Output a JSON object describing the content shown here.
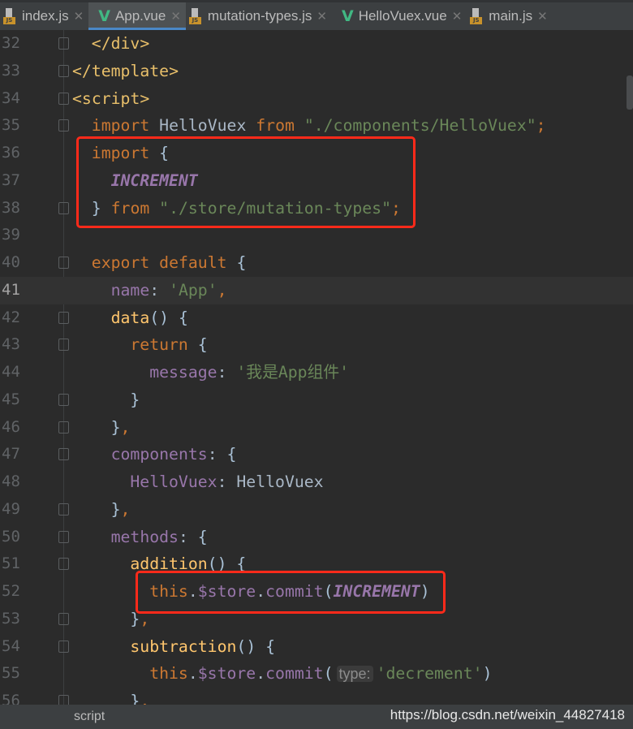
{
  "tabs": [
    {
      "label": "index.js",
      "icon": "js-file-icon",
      "active": false
    },
    {
      "label": "App.vue",
      "icon": "vue-icon",
      "active": true
    },
    {
      "label": "mutation-types.js",
      "icon": "js-file-icon",
      "active": false
    },
    {
      "label": "HelloVuex.vue",
      "icon": "vue-icon",
      "active": false
    },
    {
      "label": "main.js",
      "icon": "js-file-icon",
      "active": false
    }
  ],
  "current_line": 41,
  "lines": [
    {
      "n": "32",
      "fold": true,
      "ind": 1,
      "t": [
        [
          "tag",
          "</div>"
        ]
      ]
    },
    {
      "n": "33",
      "fold": true,
      "ind": 0,
      "t": [
        [
          "tag",
          "</template>"
        ]
      ]
    },
    {
      "n": "34",
      "fold": true,
      "ind": 0,
      "t": [
        [
          "tag",
          "<script>"
        ]
      ]
    },
    {
      "n": "35",
      "fold": true,
      "ind": 1,
      "t": [
        [
          "k",
          "import "
        ],
        [
          "n",
          "HelloVuex "
        ],
        [
          "k",
          "from "
        ],
        [
          "s",
          "\"./components/HelloVuex\""
        ],
        [
          "k",
          ";"
        ]
      ]
    },
    {
      "n": "36",
      "fold": false,
      "ind": 1,
      "t": [
        [
          "k",
          "import "
        ],
        [
          "b",
          "{"
        ]
      ]
    },
    {
      "n": "37",
      "fold": false,
      "ind": 2,
      "t": [
        [
          "c",
          "INCREMENT"
        ]
      ]
    },
    {
      "n": "38",
      "fold": true,
      "ind": 1,
      "t": [
        [
          "b",
          "} "
        ],
        [
          "k",
          "from "
        ],
        [
          "s",
          "\"./store/mutation-types\""
        ],
        [
          "k",
          ";"
        ]
      ]
    },
    {
      "n": "39",
      "fold": false,
      "ind": 0,
      "t": []
    },
    {
      "n": "40",
      "fold": true,
      "ind": 1,
      "t": [
        [
          "k",
          "export default "
        ],
        [
          "b",
          "{"
        ]
      ]
    },
    {
      "n": "41",
      "fold": false,
      "ind": 2,
      "t": [
        [
          "p",
          "name"
        ],
        [
          "n",
          ": "
        ],
        [
          "s",
          "'App'"
        ],
        [
          "k",
          ","
        ]
      ]
    },
    {
      "n": "42",
      "fold": true,
      "ind": 2,
      "t": [
        [
          "f",
          "data"
        ],
        [
          "b",
          "() {"
        ]
      ]
    },
    {
      "n": "43",
      "fold": true,
      "ind": 3,
      "t": [
        [
          "k",
          "return "
        ],
        [
          "b",
          "{"
        ]
      ]
    },
    {
      "n": "44",
      "fold": false,
      "ind": 4,
      "t": [
        [
          "p",
          "message"
        ],
        [
          "n",
          ": "
        ],
        [
          "s",
          "'我是App组件'"
        ]
      ]
    },
    {
      "n": "45",
      "fold": true,
      "ind": 3,
      "t": [
        [
          "b",
          "}"
        ]
      ]
    },
    {
      "n": "46",
      "fold": true,
      "ind": 2,
      "t": [
        [
          "b",
          "}"
        ],
        [
          "k",
          ","
        ]
      ]
    },
    {
      "n": "47",
      "fold": true,
      "ind": 2,
      "t": [
        [
          "p",
          "components"
        ],
        [
          "n",
          ": "
        ],
        [
          "b",
          "{"
        ]
      ]
    },
    {
      "n": "48",
      "fold": false,
      "ind": 3,
      "t": [
        [
          "p",
          "HelloVuex"
        ],
        [
          "n",
          ": HelloVuex"
        ]
      ]
    },
    {
      "n": "49",
      "fold": true,
      "ind": 2,
      "t": [
        [
          "b",
          "}"
        ],
        [
          "k",
          ","
        ]
      ]
    },
    {
      "n": "50",
      "fold": true,
      "ind": 2,
      "t": [
        [
          "p",
          "methods"
        ],
        [
          "n",
          ": "
        ],
        [
          "b",
          "{"
        ]
      ]
    },
    {
      "n": "51",
      "fold": true,
      "ind": 3,
      "t": [
        [
          "f",
          "addition"
        ],
        [
          "b",
          "() {"
        ]
      ]
    },
    {
      "n": "52",
      "fold": false,
      "ind": 4,
      "t": [
        [
          "k",
          "this"
        ],
        [
          "n",
          "."
        ],
        [
          "p",
          "$store"
        ],
        [
          "n",
          "."
        ],
        [
          "p",
          "commit"
        ],
        [
          "b",
          "("
        ],
        [
          "c",
          "INCREMENT"
        ],
        [
          "b",
          ")"
        ]
      ]
    },
    {
      "n": "53",
      "fold": true,
      "ind": 3,
      "t": [
        [
          "b",
          "}"
        ],
        [
          "k",
          ","
        ]
      ]
    },
    {
      "n": "54",
      "fold": true,
      "ind": 3,
      "t": [
        [
          "f",
          "subtraction"
        ],
        [
          "b",
          "() {"
        ]
      ]
    },
    {
      "n": "55",
      "fold": false,
      "ind": 4,
      "t": [
        [
          "k",
          "this"
        ],
        [
          "n",
          "."
        ],
        [
          "p",
          "$store"
        ],
        [
          "n",
          "."
        ],
        [
          "p",
          "commit"
        ],
        [
          "b",
          "("
        ],
        [
          "hint",
          "type:"
        ],
        [
          "s",
          "'decrement'"
        ],
        [
          "b",
          ")"
        ]
      ]
    },
    {
      "n": "56",
      "fold": true,
      "ind": 3,
      "t": [
        [
          "b",
          "}"
        ],
        [
          "k",
          ","
        ]
      ]
    }
  ],
  "status": {
    "breadcrumb": "script",
    "watermark": "https://blog.csdn.net/weixin_44827418"
  },
  "colors": {
    "background": "#2b2b2b",
    "keyword": "#cc7832",
    "string": "#6a8759",
    "property": "#9876aa",
    "function": "#ffc66d",
    "highlight_box": "#ff2a1a"
  }
}
